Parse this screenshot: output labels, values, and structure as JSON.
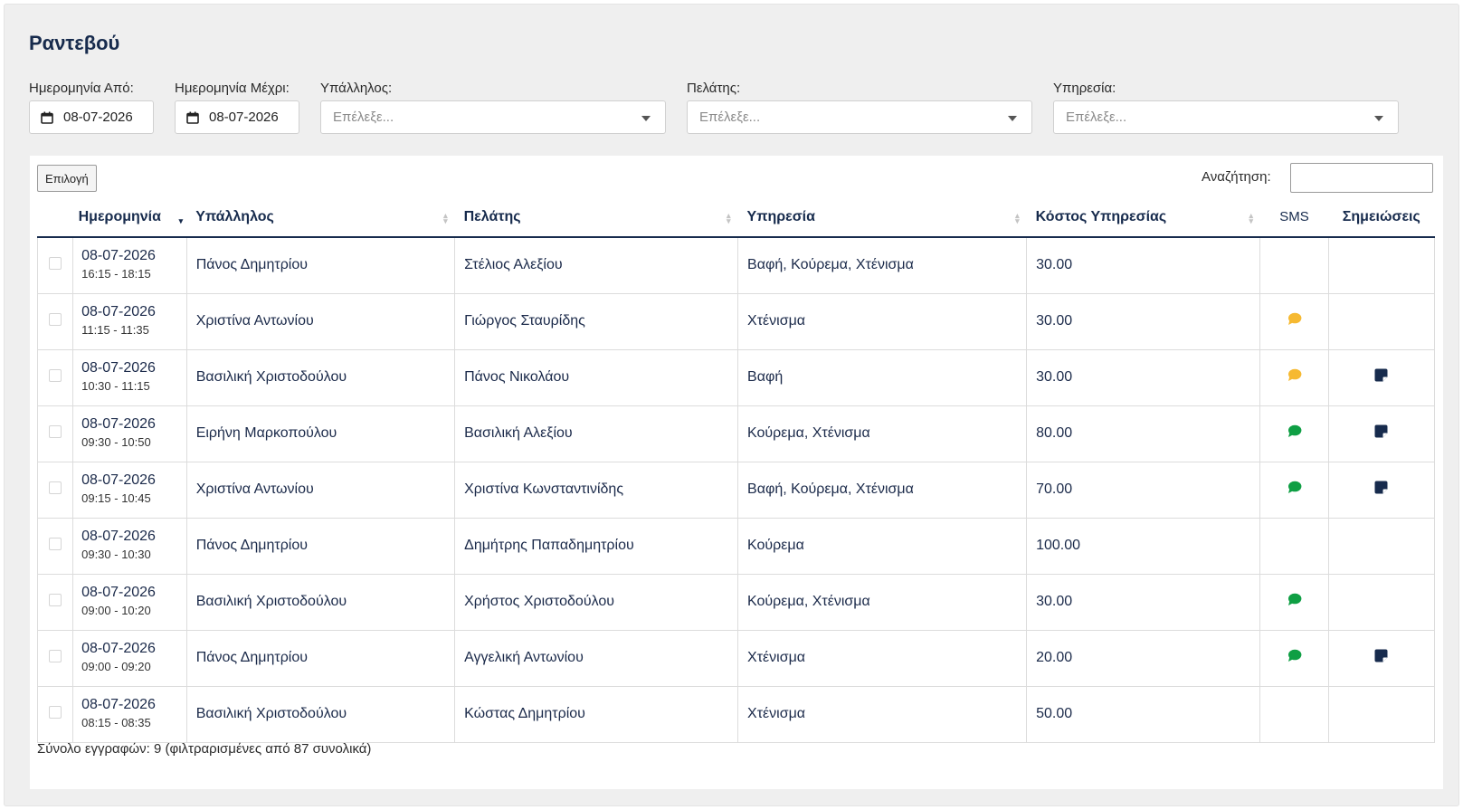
{
  "page": {
    "title": "Ραντεβού"
  },
  "filters": {
    "date_from_label": "Ημερομηνία Από:",
    "date_from_value": "08-07-2026",
    "date_to_label": "Ημερομηνία Μέχρι:",
    "date_to_value": "08-07-2026",
    "employee_label": "Υπάλληλος:",
    "employee_placeholder": "Επέλεξε...",
    "client_label": "Πελάτης:",
    "client_placeholder": "Επέλεξε...",
    "service_label": "Υπηρεσία:",
    "service_placeholder": "Επέλεξε..."
  },
  "toolbar": {
    "select_button": "Επιλογή",
    "search_label": "Αναζήτηση:"
  },
  "table": {
    "headers": {
      "date": "Ημερομηνία",
      "employee": "Υπάλληλος",
      "client": "Πελάτης",
      "service": "Υπηρεσία",
      "cost": "Κόστος Υπηρεσίας",
      "sms": "SMS",
      "notes": "Σημειώσεις"
    },
    "rows": [
      {
        "date": "08-07-2026",
        "time": "16:15 - 18:15",
        "employee": "Πάνος Δημητρίου",
        "client": "Στέλιος Αλεξίου",
        "service": "Βαφή, Κούρεμα, Χτένισμα",
        "cost": "30.00",
        "sms": "none",
        "note": false
      },
      {
        "date": "08-07-2026",
        "time": "11:15 - 11:35",
        "employee": "Χριστίνα Αντωνίου",
        "client": "Γιώργος Σταυρίδης",
        "service": "Χτένισμα",
        "cost": "30.00",
        "sms": "pending",
        "note": false
      },
      {
        "date": "08-07-2026",
        "time": "10:30 - 11:15",
        "employee": "Βασιλική Χριστοδούλου",
        "client": "Πάνος Νικολάου",
        "service": "Βαφή",
        "cost": "30.00",
        "sms": "pending",
        "note": true
      },
      {
        "date": "08-07-2026",
        "time": "09:30 - 10:50",
        "employee": "Ειρήνη Μαρκοπούλου",
        "client": "Βασιλική Αλεξίου",
        "service": "Κούρεμα, Χτένισμα",
        "cost": "80.00",
        "sms": "sent",
        "note": true
      },
      {
        "date": "08-07-2026",
        "time": "09:15 - 10:45",
        "employee": "Χριστίνα Αντωνίου",
        "client": "Χριστίνα Κωνσταντινίδης",
        "service": "Βαφή, Κούρεμα, Χτένισμα",
        "cost": "70.00",
        "sms": "sent",
        "note": true
      },
      {
        "date": "08-07-2026",
        "time": "09:30 - 10:30",
        "employee": "Πάνος Δημητρίου",
        "client": "Δημήτρης Παπαδημητρίου",
        "service": "Κούρεμα",
        "cost": "100.00",
        "sms": "none",
        "note": false
      },
      {
        "date": "08-07-2026",
        "time": "09:00 - 10:20",
        "employee": "Βασιλική Χριστοδούλου",
        "client": "Χρήστος Χριστοδούλου",
        "service": "Κούρεμα, Χτένισμα",
        "cost": "30.00",
        "sms": "sent",
        "note": false
      },
      {
        "date": "08-07-2026",
        "time": "09:00 - 09:20",
        "employee": "Πάνος Δημητρίου",
        "client": "Αγγελική Αντωνίου",
        "service": "Χτένισμα",
        "cost": "20.00",
        "sms": "sent",
        "note": true
      },
      {
        "date": "08-07-2026",
        "time": "08:15 - 08:35",
        "employee": "Βασιλική Χριστοδούλου",
        "client": "Κώστας Δημητρίου",
        "service": "Χτένισμα",
        "cost": "50.00",
        "sms": "none",
        "note": false
      }
    ]
  },
  "footer": {
    "summary": "Σύνολο εγγραφών: 9 (φιλτραρισμένες από 87 συνολικά)"
  },
  "colors": {
    "sms_pending": "#f6b931",
    "sms_sent": "#0f9f44",
    "note": "#172b4d",
    "header_text": "#172b4d"
  }
}
